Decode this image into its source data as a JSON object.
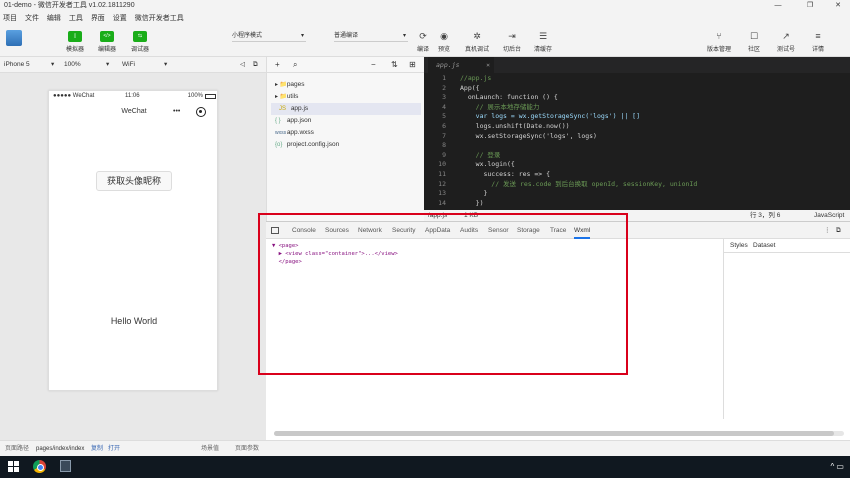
{
  "window": {
    "title": "01-demo - 微信开发者工具 v1.02.1811290",
    "controls": [
      "—",
      "❐",
      "✕"
    ]
  },
  "menu": [
    "项目",
    "文件",
    "编辑",
    "工具",
    "界面",
    "设置",
    "微信开发者工具"
  ],
  "toolbar": {
    "simulator": "模拟器",
    "editor": "编辑器",
    "debugger": "调试器",
    "mode_select": "小程序模式",
    "compile_select": "普通编译",
    "compile": "编译",
    "preview": "预览",
    "remote_debug": "真机调试",
    "background": "切后台",
    "clear_cache": "清缓存",
    "version": "版本管理",
    "community": "社区",
    "test_account": "测试号",
    "details": "详情"
  },
  "devicebar": {
    "device": "iPhone 5",
    "zoom": "100%",
    "network": "WiFi"
  },
  "phone": {
    "carrier": "●●●●● WeChat",
    "time": "11:06",
    "battery": "100%",
    "nav_title": "WeChat",
    "avatar_button": "获取头像昵称",
    "hello": "Hello World"
  },
  "sim_footer": {
    "path_label": "页面路径",
    "path": "pages/index/index",
    "copy": "复制",
    "open": "打开",
    "scene": "场景值",
    "params": "页面参数"
  },
  "filetree": {
    "items": [
      {
        "icon": "▸ 📁",
        "label": "pages"
      },
      {
        "icon": "▸ 📁",
        "label": "utils"
      },
      {
        "icon": "JS",
        "label": "app.js"
      },
      {
        "icon": "{ }",
        "label": "app.json"
      },
      {
        "icon": "wxss",
        "label": "app.wxss"
      },
      {
        "icon": "{o}",
        "label": "project.config.json"
      }
    ]
  },
  "editor": {
    "tab": "app.js",
    "lines": [
      {
        "n": "1",
        "code": "//app.js"
      },
      {
        "n": "2",
        "code": "App({"
      },
      {
        "n": "3",
        "code": "  onLaunch: function () {"
      },
      {
        "n": "4",
        "code": "    // 展示本地存储能力"
      },
      {
        "n": "5",
        "code": "    var logs = wx.getStorageSync('logs') || []"
      },
      {
        "n": "6",
        "code": "    logs.unshift(Date.now())"
      },
      {
        "n": "7",
        "code": "    wx.setStorageSync('logs', logs)"
      },
      {
        "n": "8",
        "code": ""
      },
      {
        "n": "9",
        "code": "    // 登录"
      },
      {
        "n": "10",
        "code": "    wx.login({"
      },
      {
        "n": "11",
        "code": "      success: res => {"
      },
      {
        "n": "12",
        "code": "        // 发送 res.code 到后台换取 openId, sessionKey, unionId"
      },
      {
        "n": "13",
        "code": "      }"
      },
      {
        "n": "14",
        "code": "    })"
      }
    ],
    "status_file": "/app.js",
    "status_size": "1 KB",
    "cursor": "行 3，列 6",
    "language": "JavaScript"
  },
  "devtools": {
    "tabs": [
      "Console",
      "Sources",
      "Network",
      "Security",
      "AppData",
      "Audits",
      "Sensor",
      "Storage",
      "Trace",
      "Wxml"
    ],
    "active_tab": "Wxml",
    "wxml": [
      "▼ <page>",
      "  ▶ <view class=\"container\">...</view>",
      "  </page>"
    ],
    "side_tabs": [
      "Styles",
      "Dataset"
    ]
  }
}
